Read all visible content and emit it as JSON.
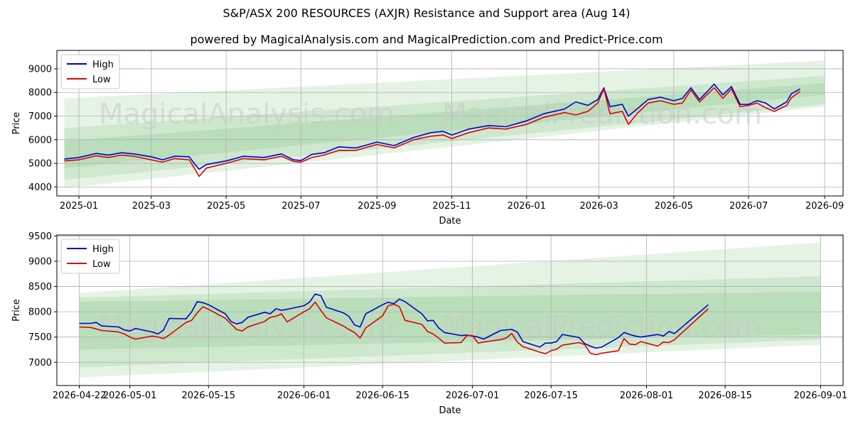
{
  "title": "S&P/ASX 200 RESOURCES (AXJR) Resistance and Support area (Aug 14)",
  "subtitle": "powered by MagicalAnalysis.com and MagicalPrediction.com and Predict-Price.com",
  "watermarks": [
    "MagicalAnalysis.com",
    "MagicalPrediction.com"
  ],
  "colors": {
    "high": "#0000cc",
    "low": "#dd0000",
    "band": "#2ca02c",
    "grid": "#b0b0b0",
    "watermark": "#c8c8c8"
  },
  "chart_data": [
    {
      "type": "line",
      "xlabel": "Date",
      "ylabel": "Price",
      "grid": true,
      "legend": "top-left",
      "xlim": [
        "2024-12-14",
        "2026-09-16"
      ],
      "ylim": [
        3620,
        9780
      ],
      "xticks": [
        "2025-01",
        "2025-03",
        "2025-05",
        "2025-07",
        "2025-09",
        "2025-11",
        "2026-01",
        "2026-03",
        "2026-05",
        "2026-07",
        "2026-09"
      ],
      "yticks": [
        4000,
        5000,
        6000,
        7000,
        8000,
        9000
      ],
      "bands": [
        {
          "x": [
            "2024-12-20",
            "2026-09-01"
          ],
          "upper": [
            7750,
            9350
          ],
          "lower": [
            3950,
            7400
          ]
        },
        {
          "x": [
            "2024-12-20",
            "2026-09-01"
          ],
          "upper": [
            6500,
            8700
          ],
          "lower": [
            4300,
            7500
          ]
        },
        {
          "x": [
            "2024-12-20",
            "2026-09-01"
          ],
          "upper": [
            5950,
            8400
          ],
          "lower": [
            4800,
            7900
          ]
        }
      ],
      "series": [
        {
          "name": "High",
          "x": [
            "2024-12-20",
            "2025-01-01",
            "2025-01-15",
            "2025-01-25",
            "2025-02-05",
            "2025-02-15",
            "2025-03-01",
            "2025-03-10",
            "2025-03-20",
            "2025-04-01",
            "2025-04-05",
            "2025-04-09",
            "2025-04-15",
            "2025-05-01",
            "2025-05-15",
            "2025-06-01",
            "2025-06-15",
            "2025-06-25",
            "2025-07-01",
            "2025-07-10",
            "2025-07-20",
            "2025-08-01",
            "2025-08-15",
            "2025-09-01",
            "2025-09-15",
            "2025-10-01",
            "2025-10-15",
            "2025-10-25",
            "2025-11-01",
            "2025-11-15",
            "2025-12-01",
            "2025-12-15",
            "2026-01-01",
            "2026-01-15",
            "2026-02-01",
            "2026-02-10",
            "2026-02-20",
            "2026-02-28",
            "2026-03-05",
            "2026-03-10",
            "2026-03-20",
            "2026-03-25",
            "2026-04-01",
            "2026-04-10",
            "2026-04-20",
            "2026-05-01",
            "2026-05-08",
            "2026-05-15",
            "2026-05-22",
            "2026-06-03",
            "2026-06-10",
            "2026-06-17",
            "2026-06-24",
            "2026-07-01",
            "2026-07-08",
            "2026-07-15",
            "2026-07-22",
            "2026-08-01",
            "2026-08-05",
            "2026-08-12"
          ],
          "values": [
            5180,
            5250,
            5420,
            5350,
            5450,
            5400,
            5280,
            5150,
            5300,
            5280,
            5000,
            4750,
            4950,
            5100,
            5300,
            5250,
            5400,
            5150,
            5120,
            5380,
            5450,
            5700,
            5650,
            5900,
            5750,
            6100,
            6300,
            6350,
            6200,
            6450,
            6600,
            6550,
            6800,
            7100,
            7300,
            7600,
            7450,
            7700,
            8200,
            7400,
            7500,
            7000,
            7300,
            7700,
            7800,
            7650,
            7750,
            8200,
            7700,
            8350,
            7900,
            8250,
            7500,
            7500,
            7650,
            7550,
            7300,
            7600,
            7950,
            8150
          ]
        },
        {
          "name": "Low",
          "x": [
            "2024-12-20",
            "2025-01-01",
            "2025-01-15",
            "2025-01-25",
            "2025-02-05",
            "2025-02-15",
            "2025-03-01",
            "2025-03-10",
            "2025-03-20",
            "2025-04-01",
            "2025-04-05",
            "2025-04-09",
            "2025-04-15",
            "2025-05-01",
            "2025-05-15",
            "2025-06-01",
            "2025-06-15",
            "2025-06-25",
            "2025-07-01",
            "2025-07-10",
            "2025-07-20",
            "2025-08-01",
            "2025-08-15",
            "2025-09-01",
            "2025-09-15",
            "2025-10-01",
            "2025-10-15",
            "2025-10-25",
            "2025-11-01",
            "2025-11-15",
            "2025-12-01",
            "2025-12-15",
            "2026-01-01",
            "2026-01-15",
            "2026-02-01",
            "2026-02-10",
            "2026-02-20",
            "2026-02-28",
            "2026-03-05",
            "2026-03-10",
            "2026-03-20",
            "2026-03-25",
            "2026-04-01",
            "2026-04-10",
            "2026-04-20",
            "2026-05-01",
            "2026-05-08",
            "2026-05-15",
            "2026-05-22",
            "2026-06-03",
            "2026-06-10",
            "2026-06-17",
            "2026-06-24",
            "2026-07-01",
            "2026-07-08",
            "2026-07-15",
            "2026-07-22",
            "2026-08-01",
            "2026-08-05",
            "2026-08-12"
          ],
          "values": [
            5100,
            5150,
            5320,
            5250,
            5350,
            5300,
            5150,
            5050,
            5200,
            5150,
            4800,
            4450,
            4800,
            5000,
            5200,
            5150,
            5300,
            5080,
            5050,
            5250,
            5350,
            5550,
            5550,
            5800,
            5650,
            6000,
            6150,
            6200,
            6050,
            6300,
            6500,
            6450,
            6650,
            6950,
            7150,
            7050,
            7200,
            7550,
            8150,
            7100,
            7200,
            6650,
            7100,
            7550,
            7650,
            7500,
            7550,
            8100,
            7600,
            8200,
            7750,
            8150,
            7400,
            7450,
            7550,
            7350,
            7200,
            7450,
            7780,
            8050
          ]
        }
      ]
    },
    {
      "type": "line",
      "xlabel": "Date",
      "ylabel": "Price",
      "grid": true,
      "legend": "top-left",
      "xlim": [
        "2026-04-18",
        "2026-09-05"
      ],
      "ylim": [
        6540,
        9520
      ],
      "xticks": [
        "2026-04-22",
        "2026-05-01",
        "2026-05-15",
        "2026-06-01",
        "2026-06-15",
        "2026-07-01",
        "2026-07-15",
        "2026-08-01",
        "2026-08-15",
        "2026-09-01"
      ],
      "yticks": [
        7000,
        7500,
        8000,
        8500,
        9000,
        9500
      ],
      "bands": [
        {
          "x": [
            "2026-04-22",
            "2026-09-01"
          ],
          "upper": [
            8370,
            9370
          ],
          "lower": [
            6700,
            7350
          ]
        },
        {
          "x": [
            "2026-04-22",
            "2026-09-01"
          ],
          "upper": [
            8280,
            8700
          ],
          "lower": [
            6900,
            7450
          ]
        },
        {
          "x": [
            "2026-04-22",
            "2026-09-01"
          ],
          "upper": [
            8200,
            8400
          ],
          "lower": [
            7250,
            7550
          ]
        }
      ],
      "series": [
        {
          "name": "High",
          "x": [
            "2026-04-22",
            "2026-04-24",
            "2026-04-25",
            "2026-04-26",
            "2026-04-29",
            "2026-04-30",
            "2026-05-01",
            "2026-05-02",
            "2026-05-05",
            "2026-05-06",
            "2026-05-07",
            "2026-05-08",
            "2026-05-11",
            "2026-05-12",
            "2026-05-13",
            "2026-05-14",
            "2026-05-15",
            "2026-05-18",
            "2026-05-19",
            "2026-05-20",
            "2026-05-21",
            "2026-05-22",
            "2026-05-25",
            "2026-05-26",
            "2026-05-27",
            "2026-05-28",
            "2026-05-29",
            "2026-06-01",
            "2026-06-02",
            "2026-06-03",
            "2026-06-04",
            "2026-06-05",
            "2026-06-08",
            "2026-06-09",
            "2026-06-10",
            "2026-06-11",
            "2026-06-12",
            "2026-06-15",
            "2026-06-16",
            "2026-06-17",
            "2026-06-18",
            "2026-06-19",
            "2026-06-22",
            "2026-06-23",
            "2026-06-24",
            "2026-06-25",
            "2026-06-26",
            "2026-06-29",
            "2026-06-30",
            "2026-07-01",
            "2026-07-02",
            "2026-07-03",
            "2026-07-06",
            "2026-07-07",
            "2026-07-08",
            "2026-07-09",
            "2026-07-10",
            "2026-07-13",
            "2026-07-14",
            "2026-07-15",
            "2026-07-16",
            "2026-07-17",
            "2026-07-20",
            "2026-07-21",
            "2026-07-22",
            "2026-07-23",
            "2026-07-24",
            "2026-07-27",
            "2026-07-28",
            "2026-07-29",
            "2026-07-30",
            "2026-07-31",
            "2026-08-03",
            "2026-08-04",
            "2026-08-05",
            "2026-08-06",
            "2026-08-12"
          ],
          "values": [
            7770,
            7770,
            7790,
            7720,
            7700,
            7640,
            7620,
            7670,
            7600,
            7560,
            7640,
            7870,
            7860,
            8000,
            8200,
            8180,
            8140,
            7960,
            7810,
            7760,
            7790,
            7890,
            7990,
            7960,
            8060,
            8030,
            8050,
            8120,
            8190,
            8350,
            8320,
            8090,
            7980,
            7910,
            7740,
            7700,
            7960,
            8140,
            8190,
            8160,
            8250,
            8200,
            7960,
            7820,
            7830,
            7680,
            7590,
            7530,
            7540,
            7520,
            7500,
            7460,
            7630,
            7640,
            7650,
            7600,
            7410,
            7300,
            7380,
            7380,
            7410,
            7550,
            7490,
            7370,
            7320,
            7280,
            7300,
            7490,
            7590,
            7550,
            7520,
            7500,
            7550,
            7520,
            7610,
            7570,
            8140
          ]
        },
        {
          "name": "Low",
          "x": [
            "2026-04-22",
            "2026-04-24",
            "2026-04-25",
            "2026-04-26",
            "2026-04-29",
            "2026-04-30",
            "2026-05-01",
            "2026-05-02",
            "2026-05-05",
            "2026-05-06",
            "2026-05-07",
            "2026-05-08",
            "2026-05-11",
            "2026-05-12",
            "2026-05-13",
            "2026-05-14",
            "2026-05-15",
            "2026-05-18",
            "2026-05-19",
            "2026-05-20",
            "2026-05-21",
            "2026-05-22",
            "2026-05-25",
            "2026-05-26",
            "2026-05-27",
            "2026-05-28",
            "2026-05-29",
            "2026-06-01",
            "2026-06-02",
            "2026-06-03",
            "2026-06-04",
            "2026-06-05",
            "2026-06-08",
            "2026-06-09",
            "2026-06-10",
            "2026-06-11",
            "2026-06-12",
            "2026-06-15",
            "2026-06-16",
            "2026-06-17",
            "2026-06-18",
            "2026-06-19",
            "2026-06-22",
            "2026-06-23",
            "2026-06-24",
            "2026-06-25",
            "2026-06-26",
            "2026-06-29",
            "2026-06-30",
            "2026-07-01",
            "2026-07-02",
            "2026-07-03",
            "2026-07-06",
            "2026-07-07",
            "2026-07-08",
            "2026-07-09",
            "2026-07-10",
            "2026-07-13",
            "2026-07-14",
            "2026-07-15",
            "2026-07-16",
            "2026-07-17",
            "2026-07-20",
            "2026-07-21",
            "2026-07-22",
            "2026-07-23",
            "2026-07-24",
            "2026-07-27",
            "2026-07-28",
            "2026-07-29",
            "2026-07-30",
            "2026-07-31",
            "2026-08-03",
            "2026-08-04",
            "2026-08-05",
            "2026-08-06",
            "2026-08-12"
          ],
          "values": [
            7700,
            7690,
            7660,
            7630,
            7600,
            7560,
            7500,
            7460,
            7520,
            7500,
            7470,
            7540,
            7790,
            7830,
            7980,
            8100,
            8050,
            7870,
            7760,
            7650,
            7620,
            7700,
            7810,
            7890,
            7910,
            7960,
            7800,
            8000,
            8060,
            8190,
            8030,
            7880,
            7720,
            7650,
            7590,
            7480,
            7680,
            7920,
            8120,
            8150,
            8100,
            7830,
            7750,
            7610,
            7560,
            7480,
            7380,
            7390,
            7530,
            7530,
            7380,
            7400,
            7450,
            7480,
            7570,
            7400,
            7310,
            7200,
            7170,
            7230,
            7260,
            7340,
            7390,
            7350,
            7180,
            7150,
            7180,
            7230,
            7470,
            7360,
            7350,
            7410,
            7320,
            7400,
            7390,
            7450,
            8060
          ]
        }
      ]
    }
  ]
}
